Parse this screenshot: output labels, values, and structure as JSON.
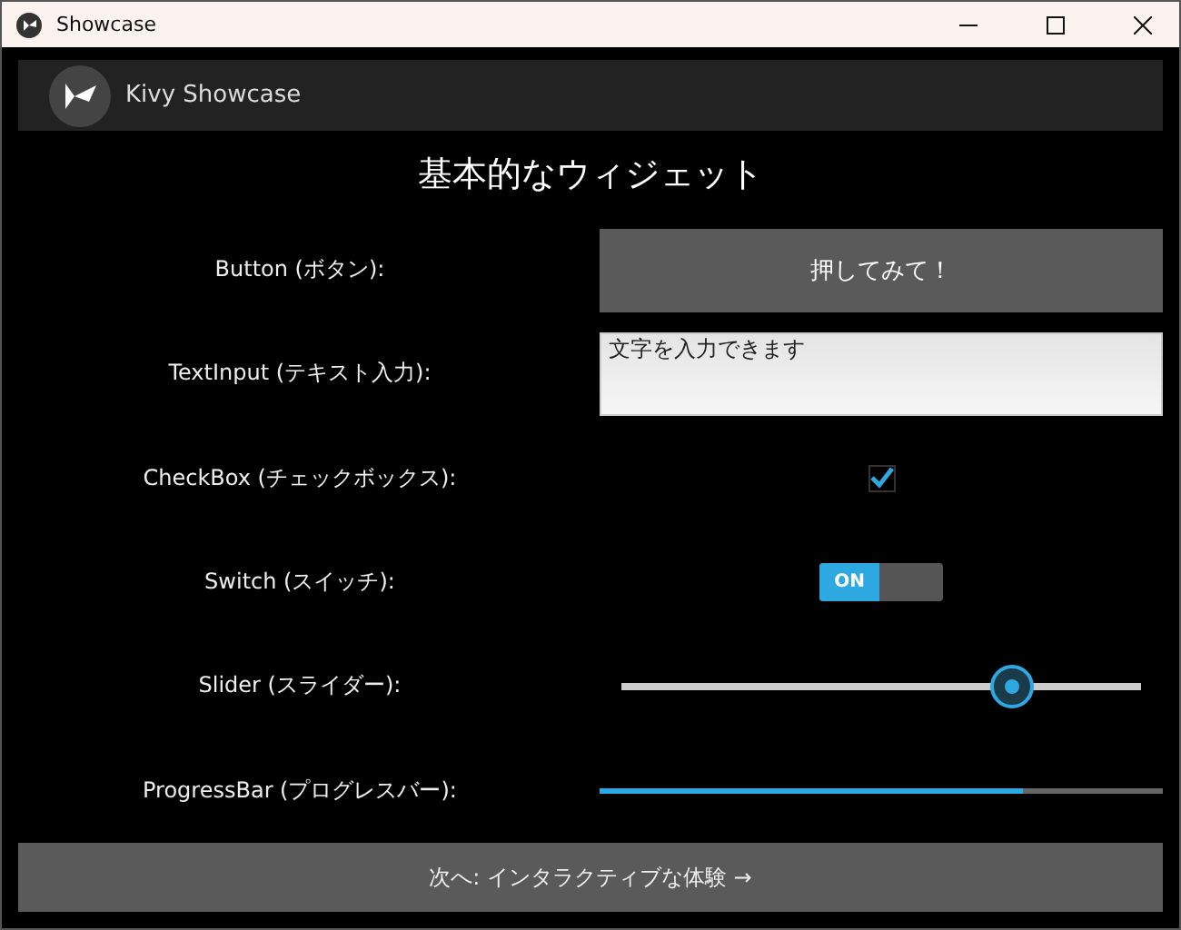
{
  "window": {
    "title": "Showcase"
  },
  "header": {
    "title": "Kivy Showcase"
  },
  "heading": "基本的なウィジェット",
  "rows": [
    {
      "kind": "button",
      "label": "Button (ボタン):",
      "text": "押してみて！"
    },
    {
      "kind": "textinput",
      "label": "TextInput (テキスト入力):",
      "value": "文字を入力できます"
    },
    {
      "kind": "checkbox",
      "label": "CheckBox (チェックボックス):",
      "checked": true
    },
    {
      "kind": "switch",
      "label": "Switch (スイッチ):",
      "on": true,
      "text": "ON"
    },
    {
      "kind": "slider",
      "label": "Slider (スライダー):",
      "level": 0.75
    },
    {
      "kind": "progress",
      "label": "ProgressBar (プログレスバー):",
      "level": 0.75
    }
  ],
  "footer_button": "次へ: インタラクティブな体験 →"
}
